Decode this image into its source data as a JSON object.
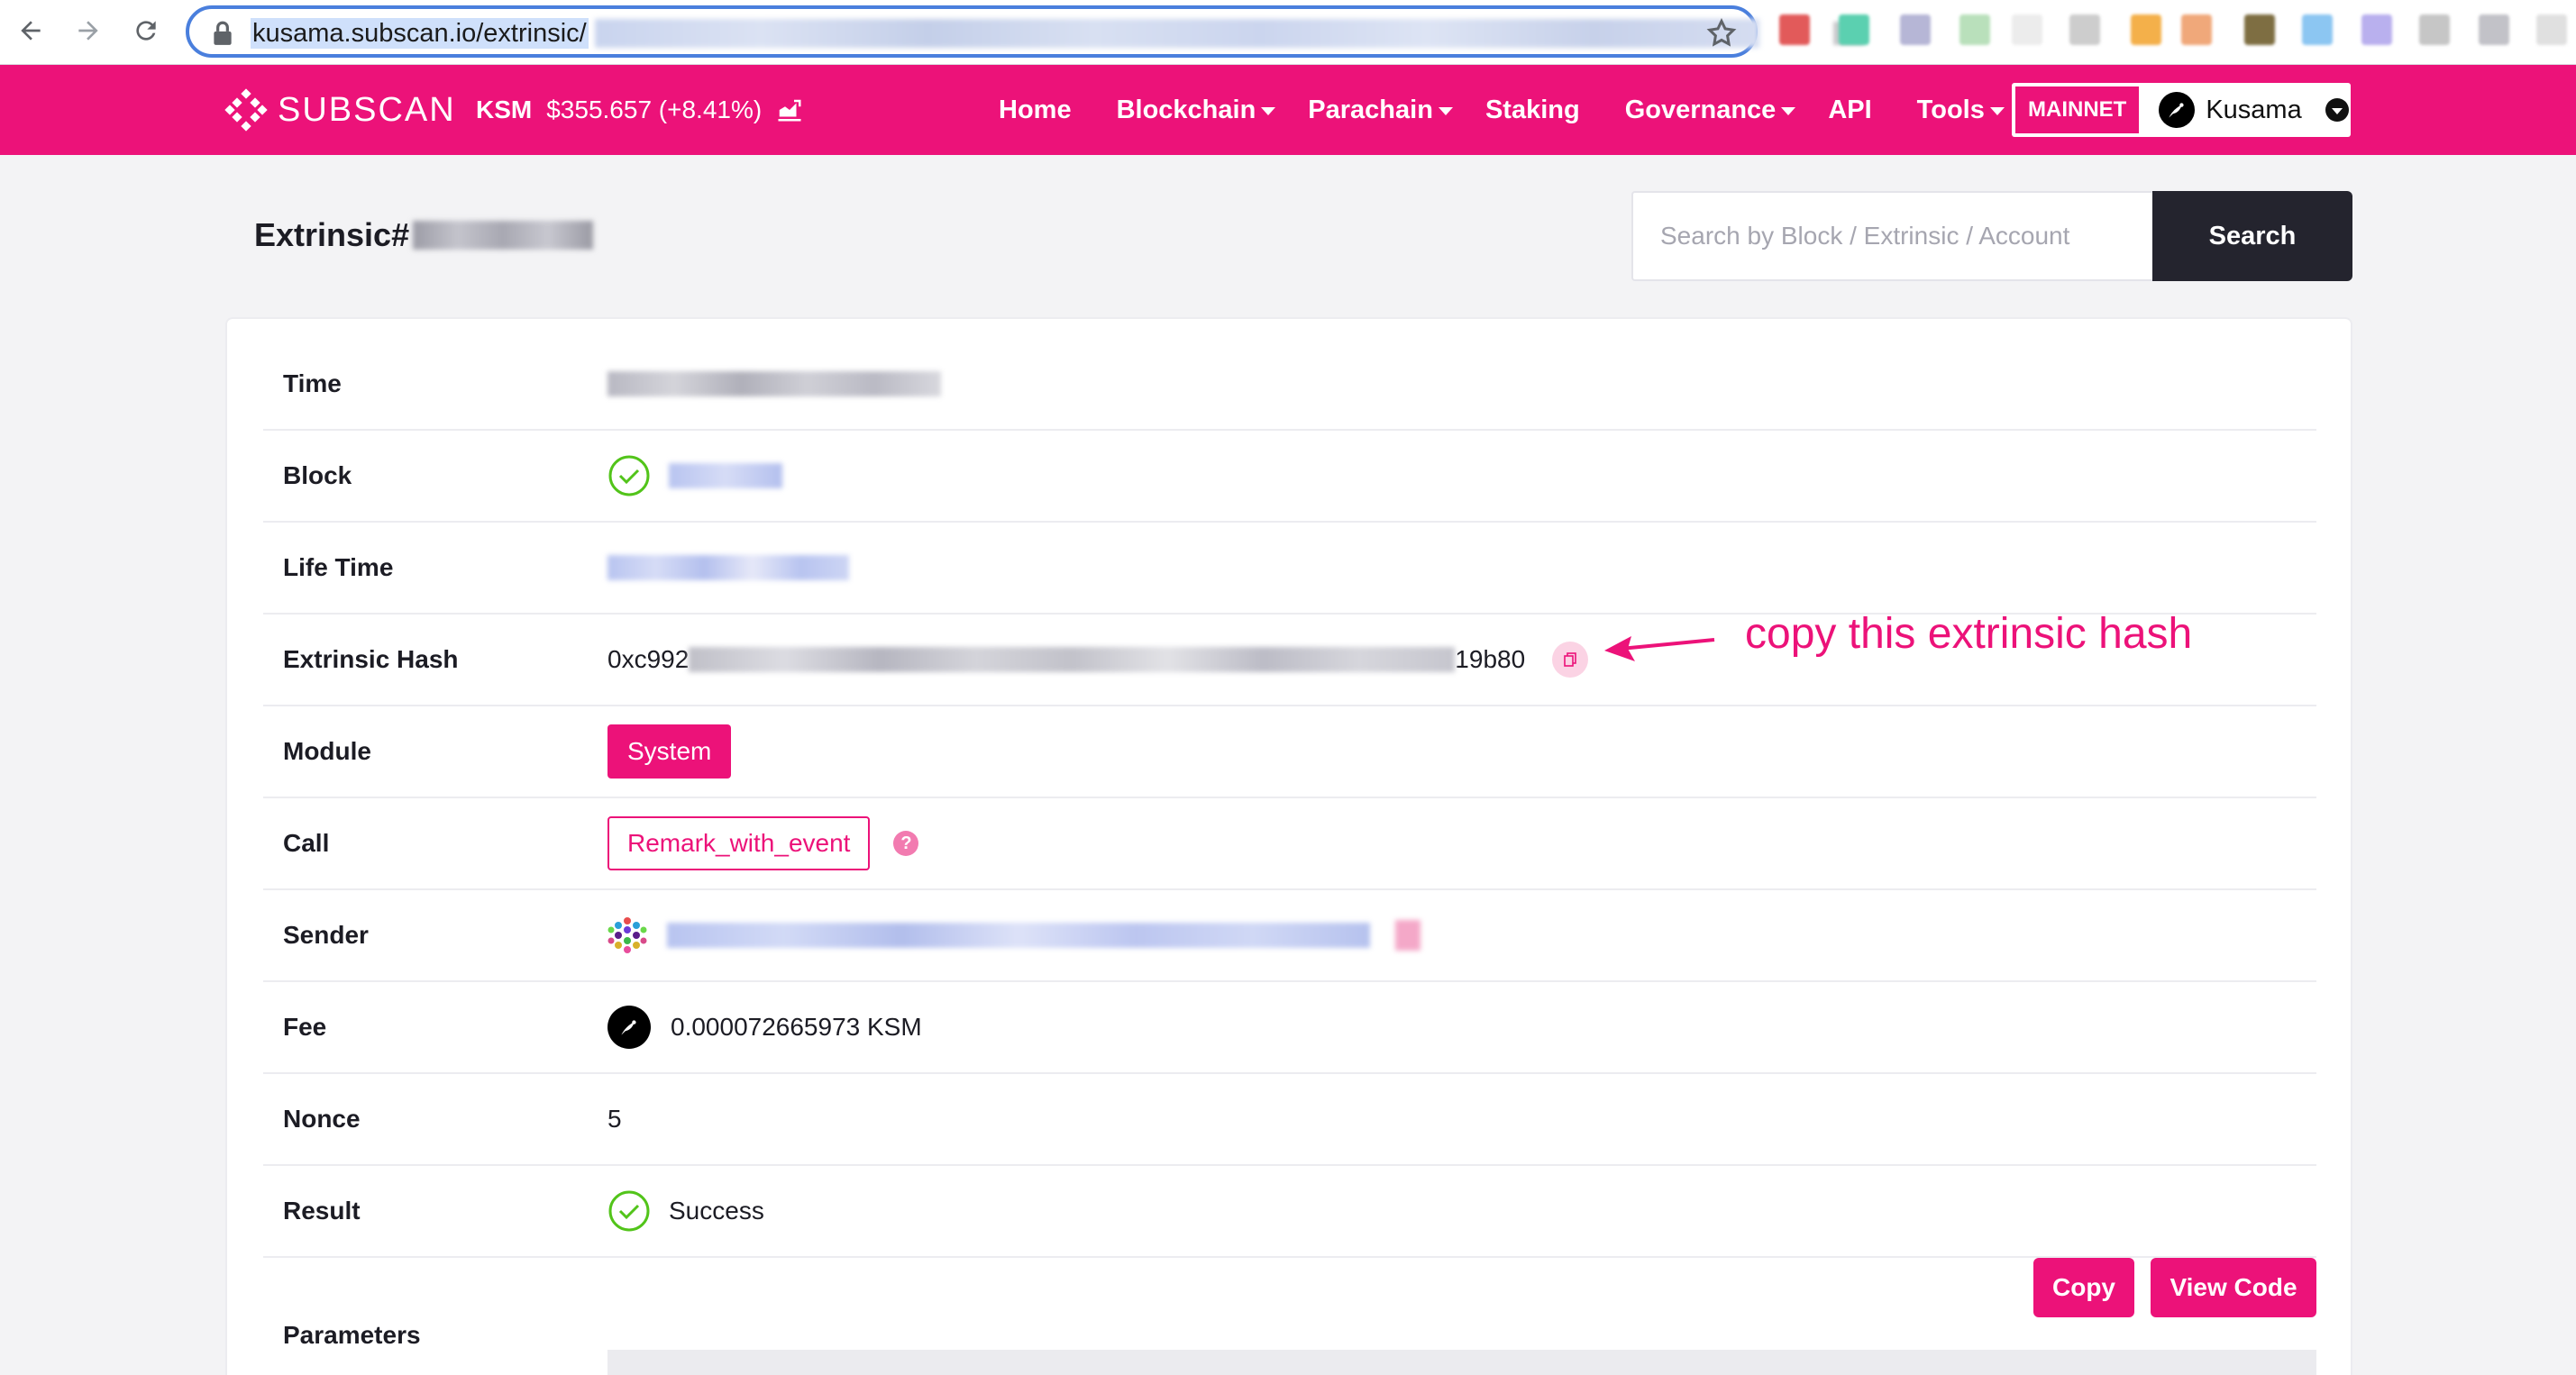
{
  "browser": {
    "url": "kusama.subscan.io/extrinsic/"
  },
  "header": {
    "logo_text": "SUBSCAN",
    "token_symbol": "KSM",
    "token_price": "$355.657 (+8.41%)",
    "menu": [
      {
        "label": "Home",
        "has_dropdown": false
      },
      {
        "label": "Blockchain",
        "has_dropdown": true
      },
      {
        "label": "Parachain",
        "has_dropdown": true
      },
      {
        "label": "Staking",
        "has_dropdown": false
      },
      {
        "label": "Governance",
        "has_dropdown": true
      },
      {
        "label": "API",
        "has_dropdown": false
      },
      {
        "label": "Tools",
        "has_dropdown": true
      }
    ],
    "network_badge": "MAINNET",
    "network_name": "Kusama",
    "brand_color": "#ec1279"
  },
  "page": {
    "title_prefix": "Extrinsic#"
  },
  "search": {
    "placeholder": "Search by Block / Extrinsic / Account",
    "button_label": "Search"
  },
  "details": {
    "time_label": "Time",
    "block_label": "Block",
    "lifetime_label": "Life Time",
    "hash_label": "Extrinsic Hash",
    "hash_start": "0xc992",
    "hash_end": "19b80",
    "module_label": "Module",
    "module_value": "System",
    "call_label": "Call",
    "call_value": "Remark_with_event",
    "sender_label": "Sender",
    "fee_label": "Fee",
    "fee_value": "0.000072665973 KSM",
    "nonce_label": "Nonce",
    "nonce_value": "5",
    "result_label": "Result",
    "result_value": "Success",
    "params_label": "Parameters",
    "copy_button": "Copy",
    "view_code_button": "View Code"
  },
  "annotation": {
    "text": "copy this extrinsic hash"
  }
}
